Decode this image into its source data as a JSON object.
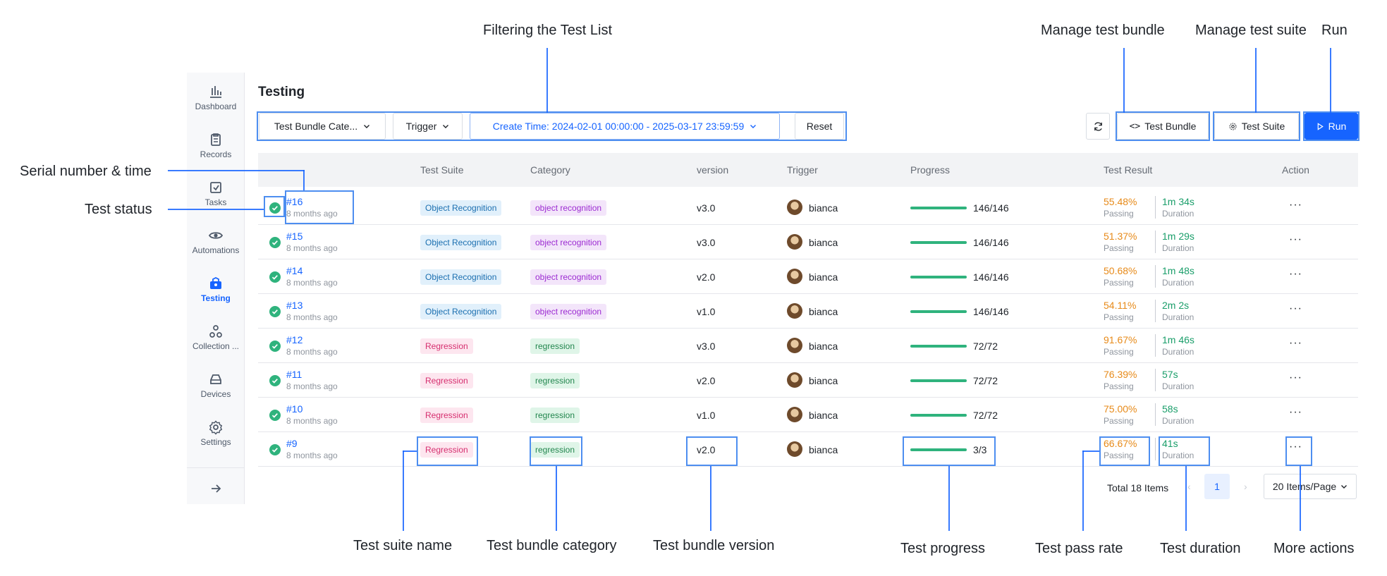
{
  "sidebar": {
    "items": [
      {
        "label": "Dashboard",
        "icon": "bar-chart-icon"
      },
      {
        "label": "Records",
        "icon": "clipboard-icon"
      },
      {
        "label": "Tasks",
        "icon": "tasks-icon"
      },
      {
        "label": "Automations",
        "icon": "eye-icon"
      },
      {
        "label": "Testing",
        "icon": "testing-icon",
        "active": true
      },
      {
        "label": "Collection ...",
        "icon": "collection-icon"
      },
      {
        "label": "Devices",
        "icon": "device-icon"
      },
      {
        "label": "Settings",
        "icon": "gear-icon"
      }
    ],
    "collapse_icon": "arrow-right-icon"
  },
  "page": {
    "title": "Testing"
  },
  "filters": {
    "category": "Test Bundle Cate...",
    "trigger": "Trigger",
    "create_time": "Create Time: 2024-02-01 00:00:00 - 2025-03-17 23:59:59",
    "reset": "Reset"
  },
  "toolbar": {
    "test_bundle": "Test Bundle",
    "test_suite": "Test Suite",
    "run": "Run"
  },
  "table": {
    "headers": {
      "test_suite": "Test Suite",
      "category": "Category",
      "version": "version",
      "trigger": "Trigger",
      "progress": "Progress",
      "test_result": "Test Result",
      "action": "Action"
    },
    "rows": [
      {
        "serial": "#16",
        "time": "8 months ago",
        "suite": "Object Recognition",
        "category": "object recognition",
        "version": "v3.0",
        "user": "bianca",
        "progress": "146/146",
        "rate": "55.48%",
        "rate_label": "Passing",
        "duration": "1m 34s",
        "duration_label": "Duration"
      },
      {
        "serial": "#15",
        "time": "8 months ago",
        "suite": "Object Recognition",
        "category": "object recognition",
        "version": "v3.0",
        "user": "bianca",
        "progress": "146/146",
        "rate": "51.37%",
        "rate_label": "Passing",
        "duration": "1m 29s",
        "duration_label": "Duration"
      },
      {
        "serial": "#14",
        "time": "8 months ago",
        "suite": "Object Recognition",
        "category": "object recognition",
        "version": "v2.0",
        "user": "bianca",
        "progress": "146/146",
        "rate": "50.68%",
        "rate_label": "Passing",
        "duration": "1m 48s",
        "duration_label": "Duration"
      },
      {
        "serial": "#13",
        "time": "8 months ago",
        "suite": "Object Recognition",
        "category": "object recognition",
        "version": "v1.0",
        "user": "bianca",
        "progress": "146/146",
        "rate": "54.11%",
        "rate_label": "Passing",
        "duration": "2m 2s",
        "duration_label": "Duration"
      },
      {
        "serial": "#12",
        "time": "8 months ago",
        "suite": "Regression",
        "category": "regression",
        "version": "v3.0",
        "user": "bianca",
        "progress": "72/72",
        "rate": "91.67%",
        "rate_label": "Passing",
        "duration": "1m 46s",
        "duration_label": "Duration"
      },
      {
        "serial": "#11",
        "time": "8 months ago",
        "suite": "Regression",
        "category": "regression",
        "version": "v2.0",
        "user": "bianca",
        "progress": "72/72",
        "rate": "76.39%",
        "rate_label": "Passing",
        "duration": "57s",
        "duration_label": "Duration"
      },
      {
        "serial": "#10",
        "time": "8 months ago",
        "suite": "Regression",
        "category": "regression",
        "version": "v1.0",
        "user": "bianca",
        "progress": "72/72",
        "rate": "75.00%",
        "rate_label": "Passing",
        "duration": "58s",
        "duration_label": "Duration"
      },
      {
        "serial": "#9",
        "time": "8 months ago",
        "suite": "Regression",
        "category": "regression",
        "version": "v2.0",
        "user": "bianca",
        "progress": "3/3",
        "rate": "66.67%",
        "rate_label": "Passing",
        "duration": "41s",
        "duration_label": "Duration"
      }
    ]
  },
  "pagination": {
    "total": "Total 18 Items",
    "current_page": "1",
    "page_size": "20 Items/Page"
  },
  "annotations": {
    "filtering": "Filtering the Test List",
    "manage_bundle": "Manage test bundle",
    "manage_suite": "Manage test suite",
    "run": "Run",
    "serial_time": "Serial number & time",
    "test_status": "Test status",
    "suite_name": "Test suite name",
    "bundle_category": "Test bundle category",
    "bundle_version": "Test bundle version",
    "test_progress": "Test progress",
    "pass_rate": "Test pass rate",
    "duration": "Test duration",
    "more_actions": "More actions"
  },
  "colors": {
    "accent": "#1664ff",
    "success": "#2fb37d",
    "pass_rate": "#e78a19",
    "duration": "#1a9e6a"
  }
}
